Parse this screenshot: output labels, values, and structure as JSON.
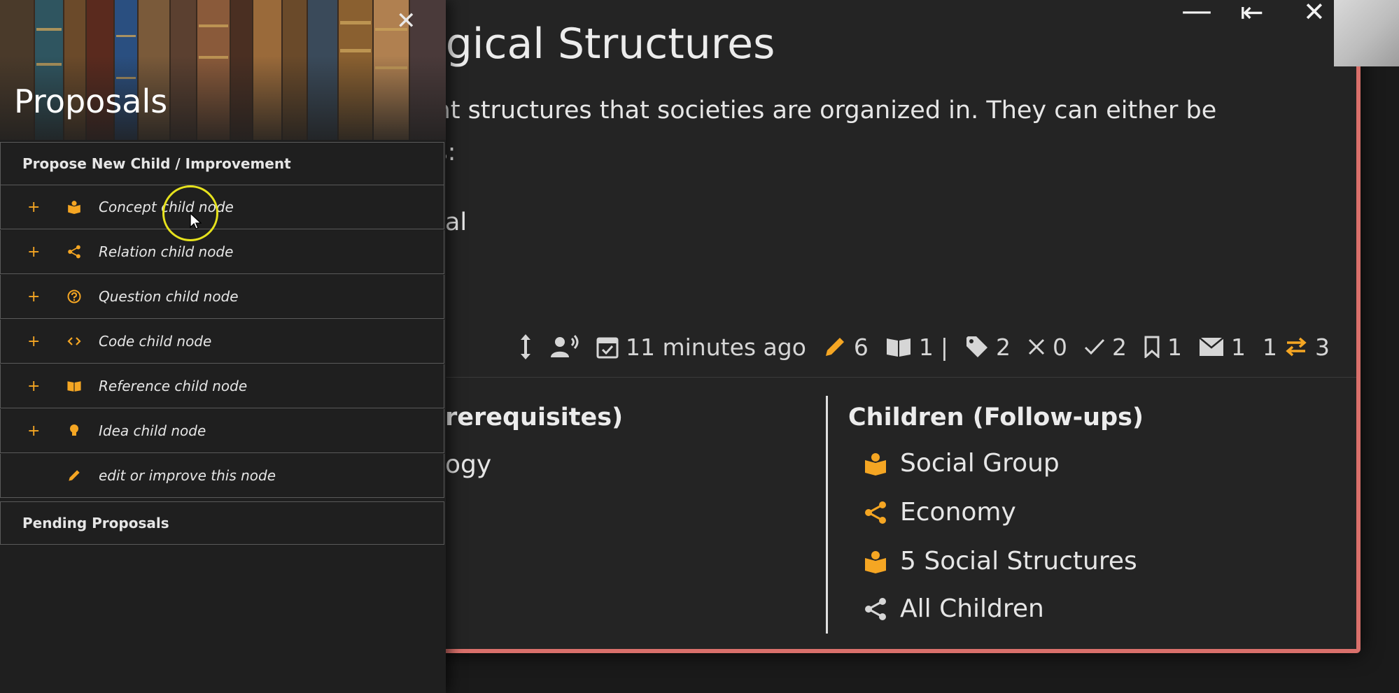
{
  "node": {
    "title": "ogical Structures",
    "text_line1": "ent structures that societies are organized in. They can either be",
    "text_line2": "as:",
    "text_line3": "ntal"
  },
  "window_controls": {
    "minimize": "—",
    "back": "⇤",
    "close": "✕"
  },
  "stats": {
    "updated": "11 minutes ago",
    "edits": "6",
    "references": "1",
    "separator": "|",
    "tags": "2",
    "wrong_votes": "0",
    "correct_votes": "2",
    "bookmarks": "1",
    "messages": "1",
    "links_left": "1",
    "links_right": "3"
  },
  "parents": {
    "heading": "rerequisites)",
    "items": [
      "ogy"
    ]
  },
  "children": {
    "heading": "Children (Follow-ups)",
    "items": [
      {
        "label": "Social Group",
        "icon": "concept-icon"
      },
      {
        "label": "Economy",
        "icon": "relation-icon"
      },
      {
        "label": "5 Social Structures",
        "icon": "concept-icon"
      },
      {
        "label": "All Children",
        "icon": "relation-icon"
      }
    ]
  },
  "sidebar": {
    "title": "Proposals",
    "close": "✕",
    "propose_heading": "Propose New Child / Improvement",
    "proposals": [
      {
        "label": "Concept child node",
        "icon": "concept-icon"
      },
      {
        "label": "Relation child node",
        "icon": "relation-icon"
      },
      {
        "label": "Question child node",
        "icon": "question-icon"
      },
      {
        "label": "Code child node",
        "icon": "code-icon"
      },
      {
        "label": "Reference child node",
        "icon": "reference-icon"
      },
      {
        "label": "Idea child node",
        "icon": "idea-icon"
      }
    ],
    "improve_label": "edit or improve this node",
    "plus": "+",
    "pending_heading": "Pending Proposals"
  },
  "colors": {
    "accent": "#f5a623",
    "card_border": "#d9706b",
    "cursor_ring": "#e6e21d"
  }
}
